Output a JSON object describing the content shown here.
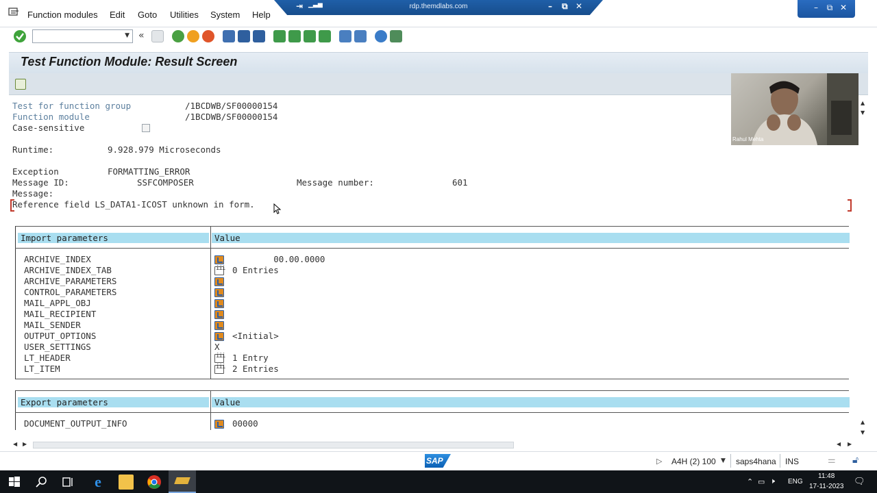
{
  "menu": {
    "items": [
      "Function modules",
      "Edit",
      "Goto",
      "Utilities",
      "System",
      "Help"
    ]
  },
  "rdp": {
    "title": "rdp.themdlabs.com"
  },
  "toolbar": {
    "command_value": ""
  },
  "page": {
    "title": "Test Function Module: Result Screen"
  },
  "info": {
    "group_label": "Test for function group",
    "group_value": "/1BCDWB/SF00000154",
    "module_label": "Function module",
    "module_value": "/1BCDWB/SF00000154",
    "case_label": "Case-sensitive",
    "runtime_label": "Runtime:",
    "runtime_value": "9.928.979 Microseconds",
    "exception_label": "Exception",
    "exception_value": "FORMATTING_ERROR",
    "msgid_label": "Message ID:",
    "msgid_value": "SSFCOMPOSER",
    "msgnum_label": "Message number:",
    "msgnum_value": "601",
    "message_label": "Message:",
    "message_value": "Reference field LS_DATA1-ICOST unknown in form."
  },
  "import_table": {
    "header_param": "Import parameters",
    "header_value": "Value",
    "rows": [
      {
        "name": "ARCHIVE_INDEX",
        "icon": "ref",
        "value": "        00.00.0000"
      },
      {
        "name": "ARCHIVE_INDEX_TAB",
        "icon": "tab",
        "value": "0 Entries"
      },
      {
        "name": "ARCHIVE_PARAMETERS",
        "icon": "ref",
        "value": ""
      },
      {
        "name": "CONTROL_PARAMETERS",
        "icon": "ref",
        "value": ""
      },
      {
        "name": "MAIL_APPL_OBJ",
        "icon": "ref",
        "value": ""
      },
      {
        "name": "MAIL_RECIPIENT",
        "icon": "ref",
        "value": ""
      },
      {
        "name": "MAIL_SENDER",
        "icon": "ref",
        "value": ""
      },
      {
        "name": "OUTPUT_OPTIONS",
        "icon": "ref",
        "value": "<Initial>"
      },
      {
        "name": "USER_SETTINGS",
        "icon": "none",
        "value": "X"
      },
      {
        "name": "LT_HEADER",
        "icon": "tab",
        "value": "1 Entry"
      },
      {
        "name": "LT_ITEM",
        "icon": "tab",
        "value": "2 Entries"
      }
    ]
  },
  "export_table": {
    "header_param": "Export parameters",
    "header_value": "Value",
    "rows": [
      {
        "name": "DOCUMENT_OUTPUT_INFO",
        "icon": "ref",
        "value": "00000"
      }
    ]
  },
  "status": {
    "system": "A4H (2) 100",
    "server": "saps4hana",
    "mode": "INS",
    "logo": "SAP"
  },
  "webcam": {
    "name": "Rahul Mehta"
  },
  "tray": {
    "lang": "ENG",
    "time": "11:48",
    "date": "17-11-2023"
  },
  "colors": {
    "header_cell": "#a9def0",
    "title_bg": "#dbe3ea",
    "label_blue": "#5c7f9e"
  }
}
